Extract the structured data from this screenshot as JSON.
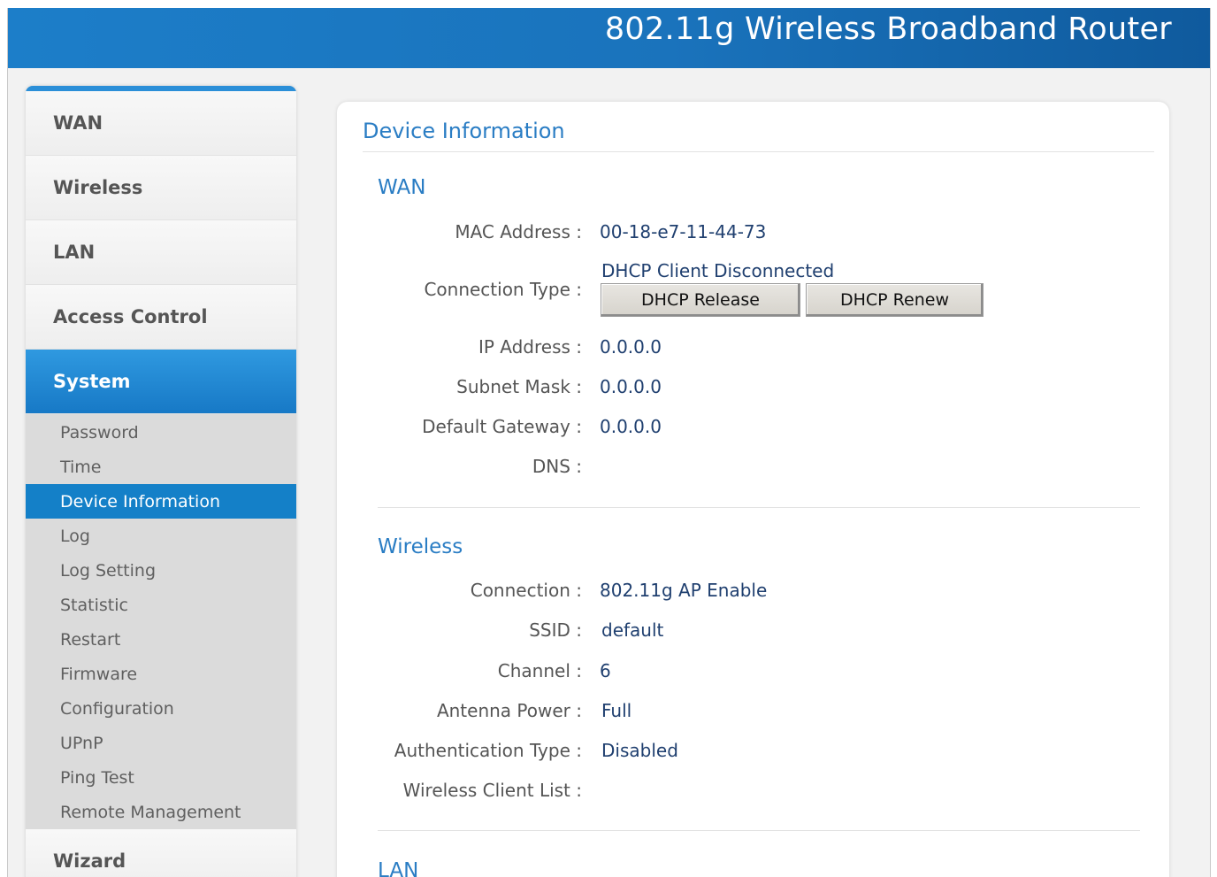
{
  "header": {
    "title": "802.11g Wireless Broadband Router"
  },
  "sidebar": {
    "menu_top": [
      "WAN",
      "Wireless",
      "LAN",
      "Access Control"
    ],
    "active_menu": "System",
    "submenu": [
      "Password",
      "Time",
      "Device Information",
      "Log",
      "Log Setting",
      "Statistic",
      "Restart",
      "Firmware",
      "Configuration",
      "UPnP",
      "Ping Test",
      "Remote Management"
    ],
    "active_submenu": "Device Information",
    "menu_bottom": [
      "Wizard"
    ]
  },
  "page": {
    "title": "Device Information",
    "wan": {
      "title": "WAN",
      "mac_label": "MAC Address :",
      "mac_value": "00-18-e7-11-44-73",
      "conn_label": "Connection Type :",
      "conn_value": "DHCP Client Disconnected",
      "release_button": "DHCP Release",
      "renew_button": "DHCP Renew",
      "ip_label": "IP Address :",
      "ip_value": "0.0.0.0",
      "mask_label": "Subnet Mask :",
      "mask_value": "0.0.0.0",
      "gateway_label": "Default Gateway :",
      "gateway_value": "0.0.0.0",
      "dns_label": "DNS :",
      "dns_value": ""
    },
    "wireless": {
      "title": "Wireless",
      "connection_label": "Connection :",
      "connection_value": "802.11g AP Enable",
      "ssid_label": "SSID :",
      "ssid_value": "default",
      "channel_label": "Channel :",
      "channel_value": "6",
      "antenna_label": "Antenna Power :",
      "antenna_value": "Full",
      "auth_label": "Authentication Type :",
      "auth_value": "Disabled",
      "clients_label": "Wireless Client List :",
      "clients_value": ""
    },
    "lan": {
      "title": "LAN"
    }
  },
  "colors": {
    "header_blue": "#1a73bc",
    "accent_blue": "#2a7dc4",
    "active_menu": "#1779c6",
    "active_submenu": "#1480c8"
  }
}
